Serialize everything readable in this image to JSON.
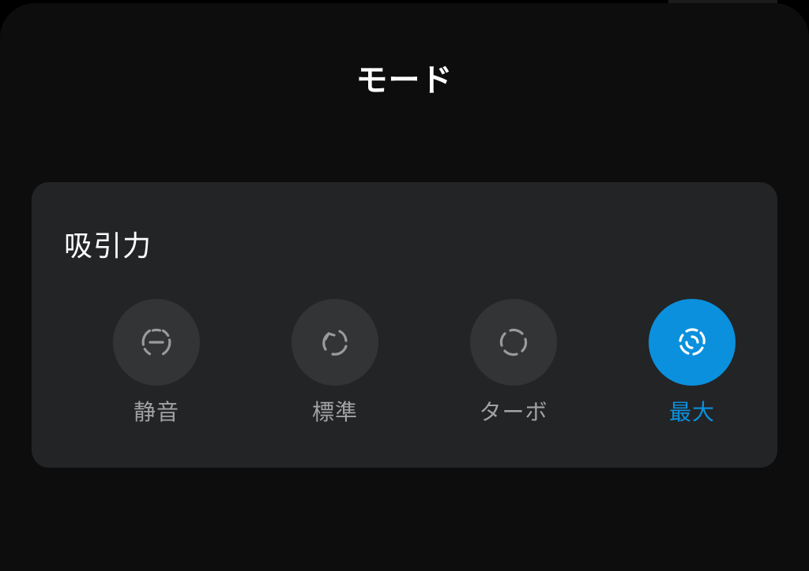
{
  "sheet": {
    "title": "モード"
  },
  "suction": {
    "title": "吸引力",
    "options": [
      {
        "label": "静音",
        "icon": "quiet-mode-icon",
        "selected": false
      },
      {
        "label": "標準",
        "icon": "standard-mode-icon",
        "selected": false
      },
      {
        "label": "ターボ",
        "icon": "turbo-mode-icon",
        "selected": false
      },
      {
        "label": "最大",
        "icon": "max-mode-icon",
        "selected": true
      }
    ]
  },
  "colors": {
    "background": "#0d0d0e",
    "card": "#232426",
    "option_idle": "#333436",
    "accent": "#0b90dd",
    "label_idle": "#a3a3a5"
  }
}
